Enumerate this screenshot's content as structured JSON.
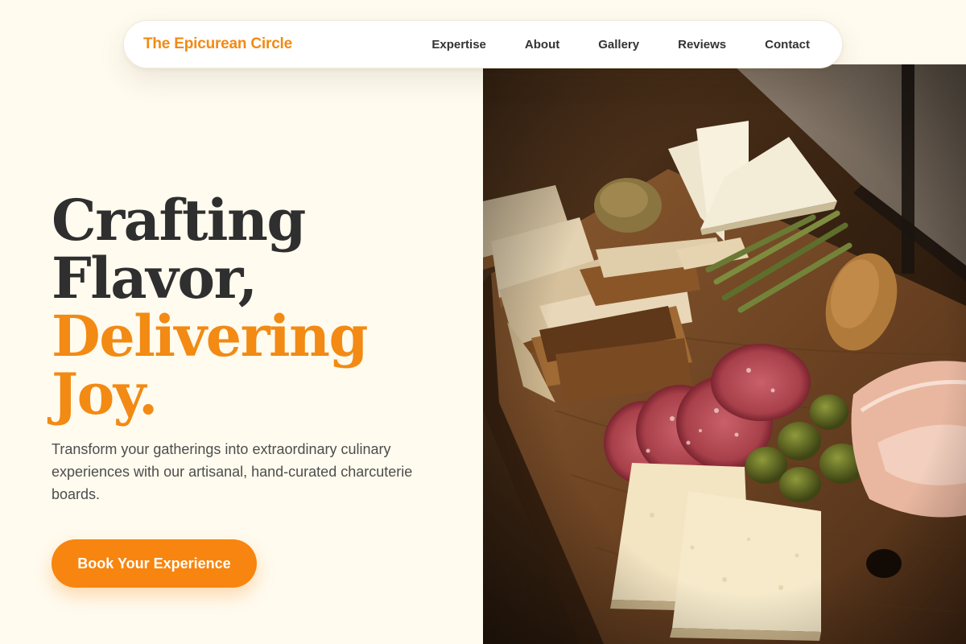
{
  "nav": {
    "brand": "The Epicurean Circle",
    "links": [
      "Expertise",
      "About",
      "Gallery",
      "Reviews",
      "Contact"
    ]
  },
  "hero": {
    "headline_dark_1": "Crafting",
    "headline_dark_2": "Flavor,",
    "headline_accent_1": "Delivering",
    "headline_accent_2": "Joy.",
    "subtitle": "Transform your gatherings into extraordinary culinary experiences with our artisanal, hand-curated charcuterie boards.",
    "cta_label": "Book Your Experience"
  },
  "colors": {
    "page_background": "#fffbef",
    "accent": "#f28a14",
    "button": "#f7850f",
    "heading_dark": "#2f2f2f",
    "body_text": "#4d4d4d"
  }
}
